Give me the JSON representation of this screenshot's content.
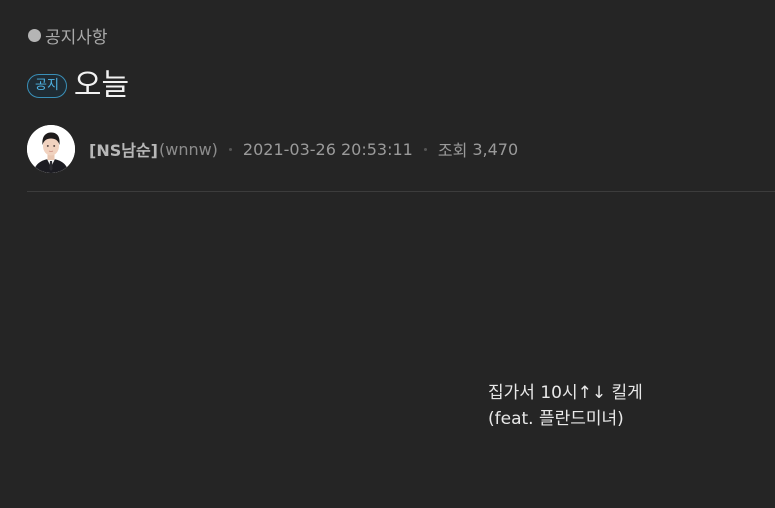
{
  "board": {
    "category": "공지사항"
  },
  "post": {
    "badge": "공지",
    "title": "오늘",
    "author_name": "[NS남순]",
    "author_id": "(wnnw)",
    "datetime": "2021-03-26 20:53:11",
    "views_label": "조회",
    "views_count": "3,470",
    "content_line1": "집가서 10시↑↓ 킬게",
    "content_line2": "(feat. 플란드미녀)"
  },
  "colors": {
    "background": "#252525",
    "badge_accent": "#4fb3e3"
  }
}
